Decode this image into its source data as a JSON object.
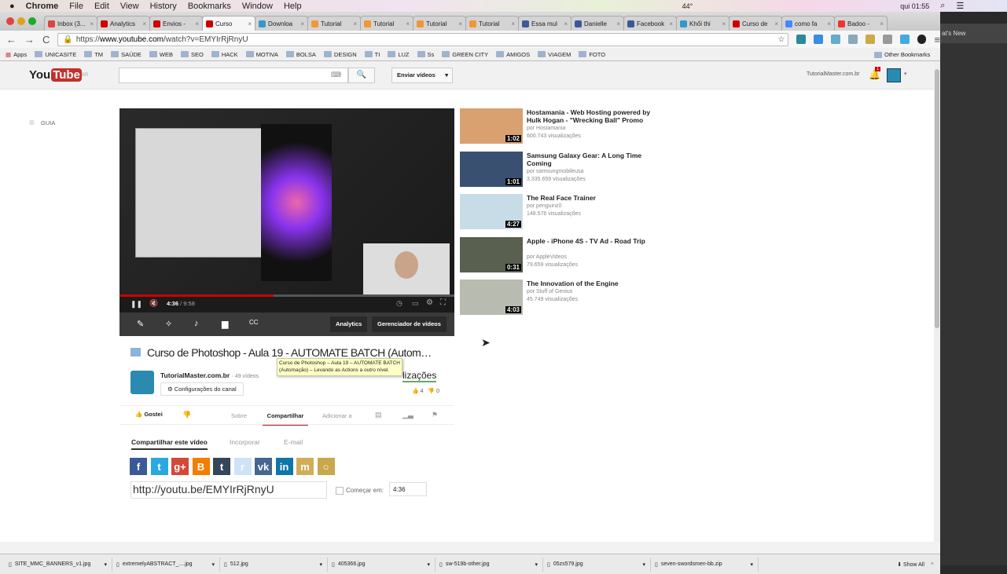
{
  "menubar": {
    "items": [
      "Chrome",
      "File",
      "Edit",
      "View",
      "History",
      "Bookmarks",
      "Window",
      "Help"
    ],
    "temp": "44°",
    "clock": "qui 01:55"
  },
  "tabs": [
    {
      "label": "Inbox (3...",
      "color": "#d44"
    },
    {
      "label": "Analytics",
      "color": "#c00"
    },
    {
      "label": "Envios -",
      "color": "#c00"
    },
    {
      "label": "Curso",
      "color": "#c00",
      "active": true
    },
    {
      "label": "Downloa",
      "color": "#39c"
    },
    {
      "label": "Tutorial",
      "color": "#e93"
    },
    {
      "label": "Tutorial",
      "color": "#e93"
    },
    {
      "label": "Tutorial",
      "color": "#e93"
    },
    {
      "label": "Tutorial",
      "color": "#e93"
    },
    {
      "label": "Essa mul",
      "color": "#3b5998"
    },
    {
      "label": "Danielle",
      "color": "#3b5998"
    },
    {
      "label": "Facebook",
      "color": "#3b5998"
    },
    {
      "label": "Khối thi",
      "color": "#39c"
    },
    {
      "label": "Curso de",
      "color": "#c00"
    },
    {
      "label": "como fa",
      "color": "#48f"
    },
    {
      "label": "Badoo -",
      "color": "#e33"
    }
  ],
  "address": {
    "scheme": "https://",
    "host": "www.youtube.com",
    "path": "/watch?v=EMYIrRjRnyU"
  },
  "bookmarks": {
    "apps": "Apps",
    "folders": [
      "UNICASITE",
      "TM",
      "SAÚDE",
      "WEB",
      "SEO",
      "HACK",
      "MOTIVA",
      "BOLSA",
      "DESIGN",
      "TI",
      "LUZ",
      "Ss",
      "GREEN CITY",
      "AMIGOS",
      "VIAGEM",
      "FOTO"
    ],
    "other": "Other Bookmarks"
  },
  "behind_window": {
    "text": "at's New"
  },
  "youtube": {
    "logo": "YouTube",
    "region": "BR",
    "search_placeholder": "",
    "upload": "Enviar vídeos",
    "account": "TutorialMaster.com.br",
    "notifications": "1",
    "guide": "GUIA",
    "player": {
      "current": "4:36",
      "duration": "9:58",
      "progress": 0.46,
      "buttons": {
        "analytics": "Analytics",
        "manager": "Gerenciador de vídeos"
      }
    },
    "title": "Curso de Photoshop - Aula 19 - AUTOMATE BATCH (Autom…",
    "tooltip": "Curso de Photoshop – Aula 19 – AUTOMATE BATCH (Automação) – Levando as Actions a outro nível.",
    "channel": {
      "name": "TutorialMaster.com.br",
      "videos": "· 49 vídeos",
      "settings": "Configurações do canal"
    },
    "views_label": "lizações",
    "likes": "4",
    "dislikes": "0",
    "actions": {
      "like": "Gostei",
      "about": "Sobre",
      "share": "Compartilhar",
      "add": "Adicionar a"
    },
    "share_tabs": [
      "Compartilhar este vídeo",
      "Incorporar",
      "E-mail"
    ],
    "share_icons": [
      {
        "name": "facebook",
        "glyph": "f",
        "color": "#3b5998"
      },
      {
        "name": "twitter",
        "glyph": "t",
        "color": "#2aa9e0"
      },
      {
        "name": "google-plus",
        "glyph": "g+",
        "color": "#d34836"
      },
      {
        "name": "blogger",
        "glyph": "B",
        "color": "#f57d00"
      },
      {
        "name": "tumblr",
        "glyph": "t",
        "color": "#35465c"
      },
      {
        "name": "reddit",
        "glyph": "r",
        "color": "#cee3f8"
      },
      {
        "name": "vkontakte",
        "glyph": "vk",
        "color": "#45668e"
      },
      {
        "name": "linkedin",
        "glyph": "in",
        "color": "#0e76a8"
      },
      {
        "name": "mixi",
        "glyph": "m",
        "color": "#d1ad59"
      },
      {
        "name": "other",
        "glyph": "○",
        "color": "#c9a84c"
      }
    ],
    "share_url": "http://youtu.be/EMYIrRjRnyU",
    "start_at_label": "Começar em:",
    "start_at": "4:36",
    "related": [
      {
        "title": "Hostamania - Web Hosting powered by Hulk Hogan - \"Wrecking Ball\" Promo",
        "by": "por Hostamania",
        "views": "600.743 visualizações",
        "duration": "1:02",
        "color": "#d9a070"
      },
      {
        "title": "Samsung Galaxy Gear: A Long Time Coming",
        "by": "por samsungmobileusa",
        "views": "3.335.659 visualizações",
        "duration": "1:01",
        "color": "#3a5070"
      },
      {
        "title": "The Real Face Trainer",
        "by": "por penguinz0",
        "views": "148.576 visualizações",
        "duration": "4:27",
        "color": "#c8dce8"
      },
      {
        "title": "Apple - iPhone 4S - TV Ad - Road Trip",
        "by": "por AppleVideos",
        "views": "79.659 visualizações",
        "duration": "0:31",
        "color": "#5a6050"
      },
      {
        "title": "The Innovation of the Engine",
        "by": "por Stuff of Genius",
        "views": "45.749 visualizações",
        "duration": "4:03",
        "color": "#b8bcb0"
      }
    ]
  },
  "downloads": {
    "files": [
      "SITE_MMC_BANNERS_v1.jpg",
      "extremelyABSTRACT_....jpg",
      "512.jpg",
      "405366.jpg",
      "sw-519b-other.jpg",
      "05zs579.jpg",
      "seven-swordsmen-bb.zip"
    ],
    "show_all": "Show All"
  }
}
